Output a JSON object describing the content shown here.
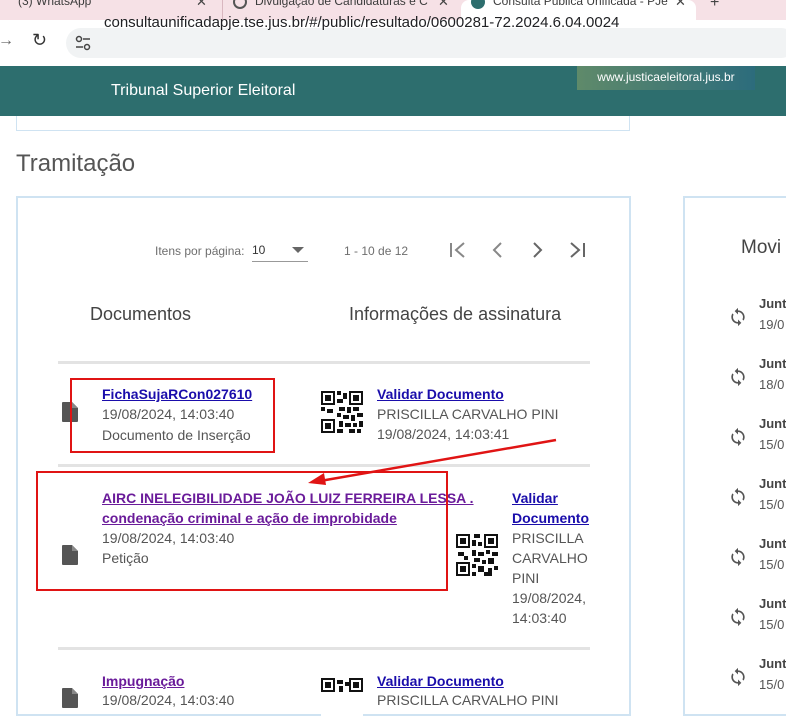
{
  "browser": {
    "tabs": [
      {
        "label": "(3) WhatsApp"
      },
      {
        "label": "Divulgação de Candidaturas e C"
      },
      {
        "label": "Consulta Pública Unificada - PJe"
      }
    ],
    "url": "consultaunificadapje.tse.jus.br/#/public/resultado/0600281-72.2024.6.04.0024"
  },
  "header": {
    "title": "Tribunal Superior Eleitoral",
    "portal": "www.justicaeleitoral.jus.br"
  },
  "section_title": "Tramitação",
  "paginator": {
    "items_label": "Itens por página:",
    "page_size": "10",
    "range": "1 - 10 de 12"
  },
  "columns": {
    "documents": "Documentos",
    "signature": "Informações de assinatura"
  },
  "documents": [
    {
      "title": "FichaSujaRCon027610",
      "date": "19/08/2024, 14:03:40",
      "type": "Documento de Inserção",
      "validate": "Validar Documento",
      "signer": "PRISCILLA CARVALHO PINI",
      "signed_at": "19/08/2024, 14:03:41"
    },
    {
      "title_line1": "AIRC INELEGIBILIDADE JOÃO LUIZ FERREIRA LESSA .",
      "title_line2": "condenação criminal e ação de improbidade",
      "date": "19/08/2024, 14:03:40",
      "type": "Petição",
      "validate_line1": "Validar",
      "validate_line2": "Documento",
      "signer_line1": "PRISCILLA",
      "signer_line2": "CARVALHO",
      "signer_line3": "PINI",
      "signed_line1": "19/08/2024,",
      "signed_line2": "14:03:40"
    },
    {
      "title": "Impugnação",
      "date": "19/08/2024, 14:03:40",
      "validate": "Validar Documento",
      "signer": "PRISCILLA CARVALHO PINI"
    }
  ],
  "movements": {
    "title": "Movi",
    "items": [
      {
        "label": "Junt",
        "date": "19/0"
      },
      {
        "label": "Junt",
        "date": "18/0"
      },
      {
        "label": "Junt",
        "date": "15/0"
      },
      {
        "label": "Junt",
        "date": "15/0"
      },
      {
        "label": "Junt",
        "date": "15/0"
      },
      {
        "label": "Junt",
        "date": "15/0"
      },
      {
        "label": "Junt",
        "date": "15/0"
      }
    ]
  },
  "colors": {
    "header": "#2d6e6e",
    "annotation": "#e01414",
    "link": "#1a0dab",
    "visited": "#6a1b9a",
    "tabbar": "#f6e1e6"
  }
}
